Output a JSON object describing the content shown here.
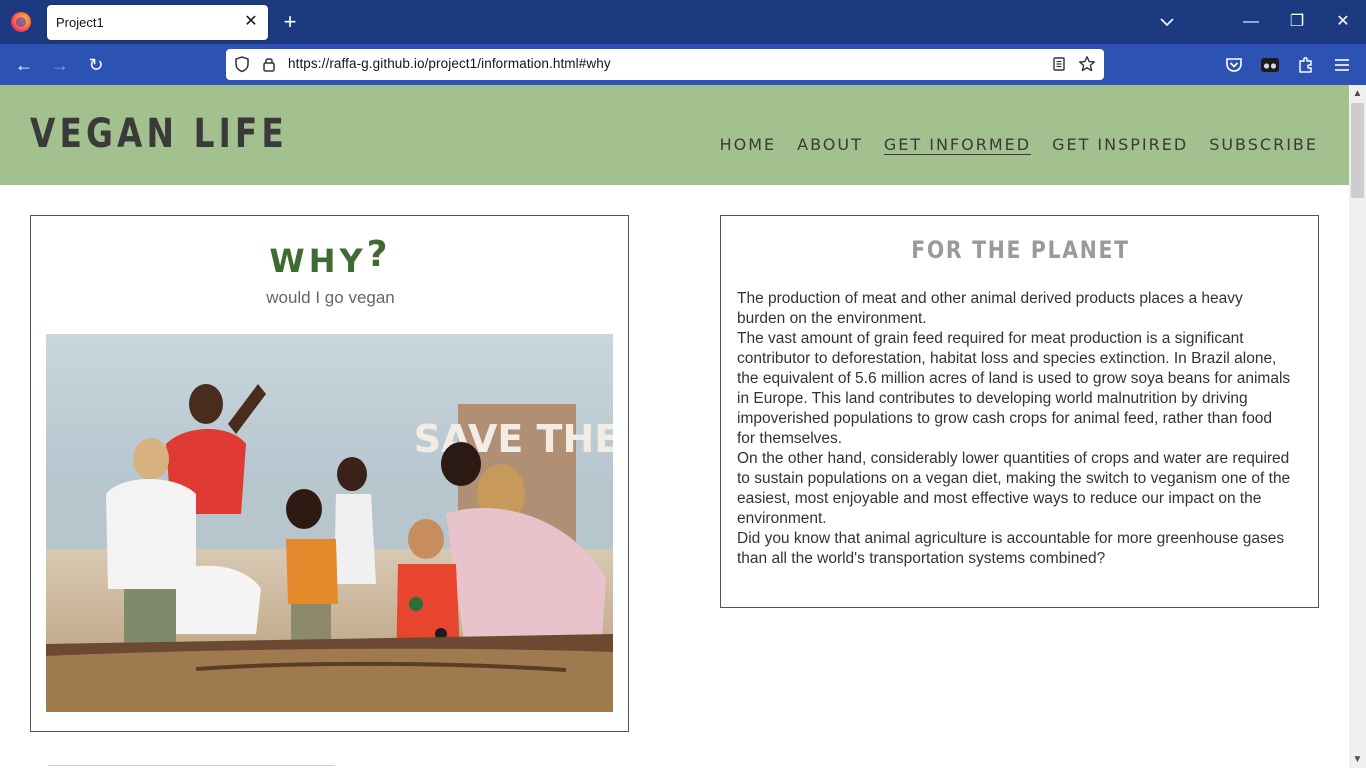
{
  "browser": {
    "tab_title": "Project1",
    "tab_close": "✕",
    "new_tab": "+",
    "url": "https://raffa-g.github.io/project1/information.html#why",
    "window": {
      "minimize": "—",
      "restore": "❐",
      "close": "✕"
    },
    "nav": {
      "back": "←",
      "forward": "→",
      "reload": "↻"
    }
  },
  "site": {
    "brand": "VEGAN LIFE",
    "menu": [
      {
        "label": "HOME"
      },
      {
        "label": "ABOUT"
      },
      {
        "label": "GET INFORMED",
        "active": true
      },
      {
        "label": "GET INSPIRED"
      },
      {
        "label": "SUBSCRIBE"
      }
    ],
    "colors": {
      "header_bg": "#a3c08f",
      "accent_green": "#3f6b32"
    }
  },
  "why_card": {
    "title": "WHY",
    "title_mark": "?",
    "subtitle": "would I go vegan",
    "image_sign_text": "SAVE THE"
  },
  "planet_card": {
    "title": "FOR THE PLANET",
    "paragraphs": [
      "The production of meat and other animal derived products places a heavy burden on the environment.",
      "The vast amount of grain feed required for meat production is a significant contributor to deforestation, habitat loss and species extinction. In Brazil alone, the equivalent of 5.6 million acres of land is used to grow soya beans for animals in Europe. This land contributes to developing world malnutrition by driving impoverished populations to grow cash crops for animal feed, rather than food for themselves.",
      "On the other hand, considerably lower quantities of crops and water are required to sustain populations on a vegan diet, making the switch to veganism one of the easiest, most enjoyable and most effective ways to reduce our impact on the environment.",
      "Did you know that animal agriculture is accountable for more greenhouse gases than all the world's transportation systems combined?"
    ]
  }
}
